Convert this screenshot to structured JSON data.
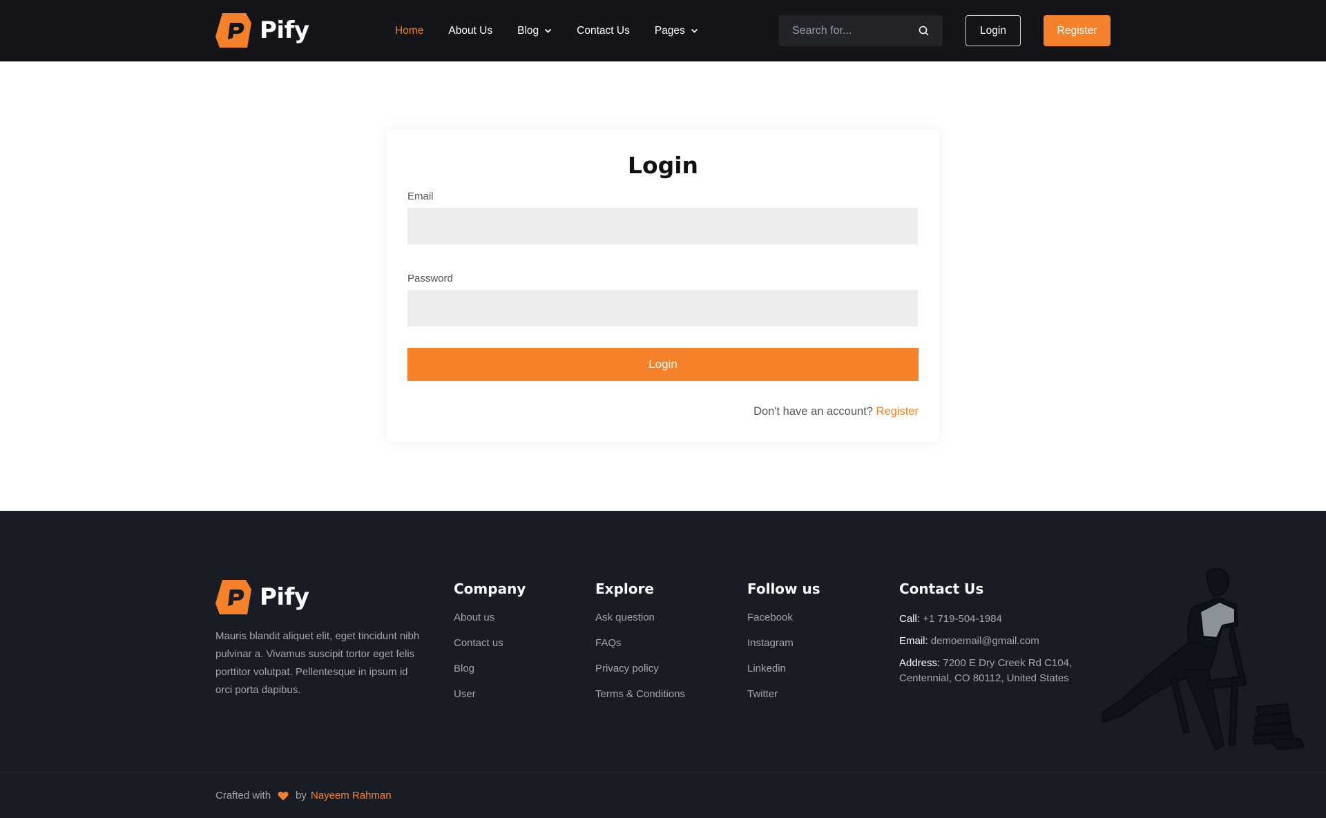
{
  "brand": {
    "name": "Pify",
    "accent": "#f5822a"
  },
  "header": {
    "nav": [
      {
        "label": "Home",
        "active": true,
        "dropdown": false
      },
      {
        "label": "About Us",
        "active": false,
        "dropdown": false
      },
      {
        "label": "Blog",
        "active": false,
        "dropdown": true
      },
      {
        "label": "Contact Us",
        "active": false,
        "dropdown": false
      },
      {
        "label": "Pages",
        "active": false,
        "dropdown": true
      }
    ],
    "search": {
      "placeholder": "Search for...",
      "icon": "search-icon"
    },
    "login_label": "Login",
    "register_label": "Register"
  },
  "login_form": {
    "title": "Login",
    "email_label": "Email",
    "email_value": "",
    "password_label": "Password",
    "password_value": "",
    "submit_label": "Login",
    "signup_prompt": "Don't have an account?",
    "signup_link": "Register"
  },
  "footer": {
    "about": "Mauris blandit aliquet elit, eget tincidunt nibh pulvinar a. Vivamus suscipit tortor eget felis porttitor volutpat. Pellentesque in ipsum id orci porta dapibus.",
    "columns": [
      {
        "title": "Company",
        "links": [
          "About us",
          "Contact us",
          "Blog",
          "User"
        ]
      },
      {
        "title": "Explore",
        "links": [
          "Ask question",
          "FAQs",
          "Privacy policy",
          "Terms & Conditions"
        ]
      },
      {
        "title": "Follow us",
        "links": [
          "Facebook",
          "Instagram",
          "Linkedin",
          "Twitter"
        ]
      }
    ],
    "contact": {
      "title": "Contact Us",
      "call_label": "Call:",
      "call_value": "+1 719-504-1984",
      "email_label": "Email:",
      "email_value": "demoemail@gmail.com",
      "address_label": "Address:",
      "address_value": "7200 E Dry Creek Rd C104, Centennial, CO 80112, United States"
    },
    "credits": {
      "prefix": "Crafted with",
      "by": "by",
      "author": "Nayeem Rahman",
      "icon": "heart-icon"
    }
  }
}
